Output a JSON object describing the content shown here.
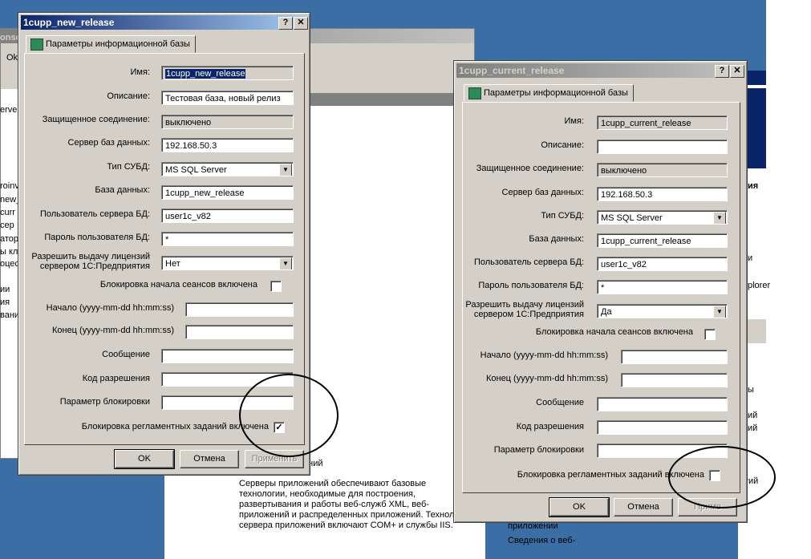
{
  "background": {
    "left_fragments": [
      "onso",
      "Ok",
      "erve",
      "roinv",
      "new_",
      "curr",
      "сер",
      "атор",
      "ы кл",
      "оцес",
      "ии",
      "ия",
      "вани"
    ],
    "bottom_header": "ений",
    "bottom_text": [
      "Серверы приложений обеспечивают базовые",
      "технологии, необходимые для построения,",
      "развертывания и работы веб-служб XML, веб-",
      "приложений и распределенных приложений. Технол",
      "сервера приложений включают COM+ и службы IIS."
    ],
    "right_fragments": [
      "ия",
      "и",
      "plorer",
      "ы",
      "ий",
      "ий",
      "тий"
    ],
    "right_bottom": [
      "приложении",
      "Сведения о веб-"
    ]
  },
  "dialog1": {
    "title": "1cupp_new_release",
    "tab": "Параметры информационной базы",
    "fields": {
      "name_label": "Имя:",
      "name": "1cupp_new_release",
      "desc_label": "Описание:",
      "desc": "Тестовая база, новый релиз",
      "secure_label": "Защищенное соединение:",
      "secure": "выключено",
      "server_label": "Сервер баз данных:",
      "server": "192.168.50.3",
      "dbms_label": "Тип СУБД:",
      "dbms": "MS SQL Server",
      "db_label": "База данных:",
      "db": "1cupp_new_release",
      "user_label": "Пользователь сервера БД:",
      "user": "user1c_v82",
      "pass_label": "Пароль пользователя БД:",
      "pass": "*",
      "license_label": "Разрешить выдачу лицензий сервером 1С:Предприятия",
      "license": "Нет",
      "session_lock_label": "Блокировка начала сеансов включена",
      "start_label": "Начало (yyyy-mm-dd hh:mm:ss)",
      "start": "",
      "end_label": "Конец (yyyy-mm-dd hh:mm:ss)",
      "end": "",
      "message_label": "Сообщение",
      "message": "",
      "code_label": "Код разрешения",
      "code": "",
      "param_label": "Параметр блокировки",
      "param": "",
      "jobs_lock_label": "Блокировка регламентных заданий включена",
      "jobs_lock_checked": "✓"
    },
    "buttons": {
      "ok": "OK",
      "cancel": "Отмена",
      "apply": "Применить"
    }
  },
  "dialog2": {
    "title": "1cupp_current_release",
    "tab": "Параметры информационной базы",
    "fields": {
      "name_label": "Имя:",
      "name": "1cupp_current_release",
      "desc_label": "Описание:",
      "desc": "",
      "secure_label": "Защищенное соединение:",
      "secure": "выключено",
      "server_label": "Сервер баз данных:",
      "server": "192.168.50.3",
      "dbms_label": "Тип СУБД:",
      "dbms": "MS SQL Server",
      "db_label": "База данных:",
      "db": "1cupp_current_release",
      "user_label": "Пользователь сервера БД:",
      "user": "user1c_v82",
      "pass_label": "Пароль пользователя БД:",
      "pass": "*",
      "license_label": "Разрешить выдачу лицензий сервером 1С:Предприятия",
      "license": "Да",
      "session_lock_label": "Блокировка начала сеансов включена",
      "start_label": "Начало (yyyy-mm-dd hh:mm:ss)",
      "start": "",
      "end_label": "Конец (yyyy-mm-dd hh:mm:ss)",
      "end": "",
      "message_label": "Сообщение",
      "message": "",
      "code_label": "Код разрешения",
      "code": "",
      "param_label": "Параметр блокировки",
      "param": "",
      "jobs_lock_label": "Блокировка регламентных заданий включена"
    },
    "buttons": {
      "ok": "OK",
      "cancel": "Отмена",
      "apply": "Приме"
    }
  }
}
